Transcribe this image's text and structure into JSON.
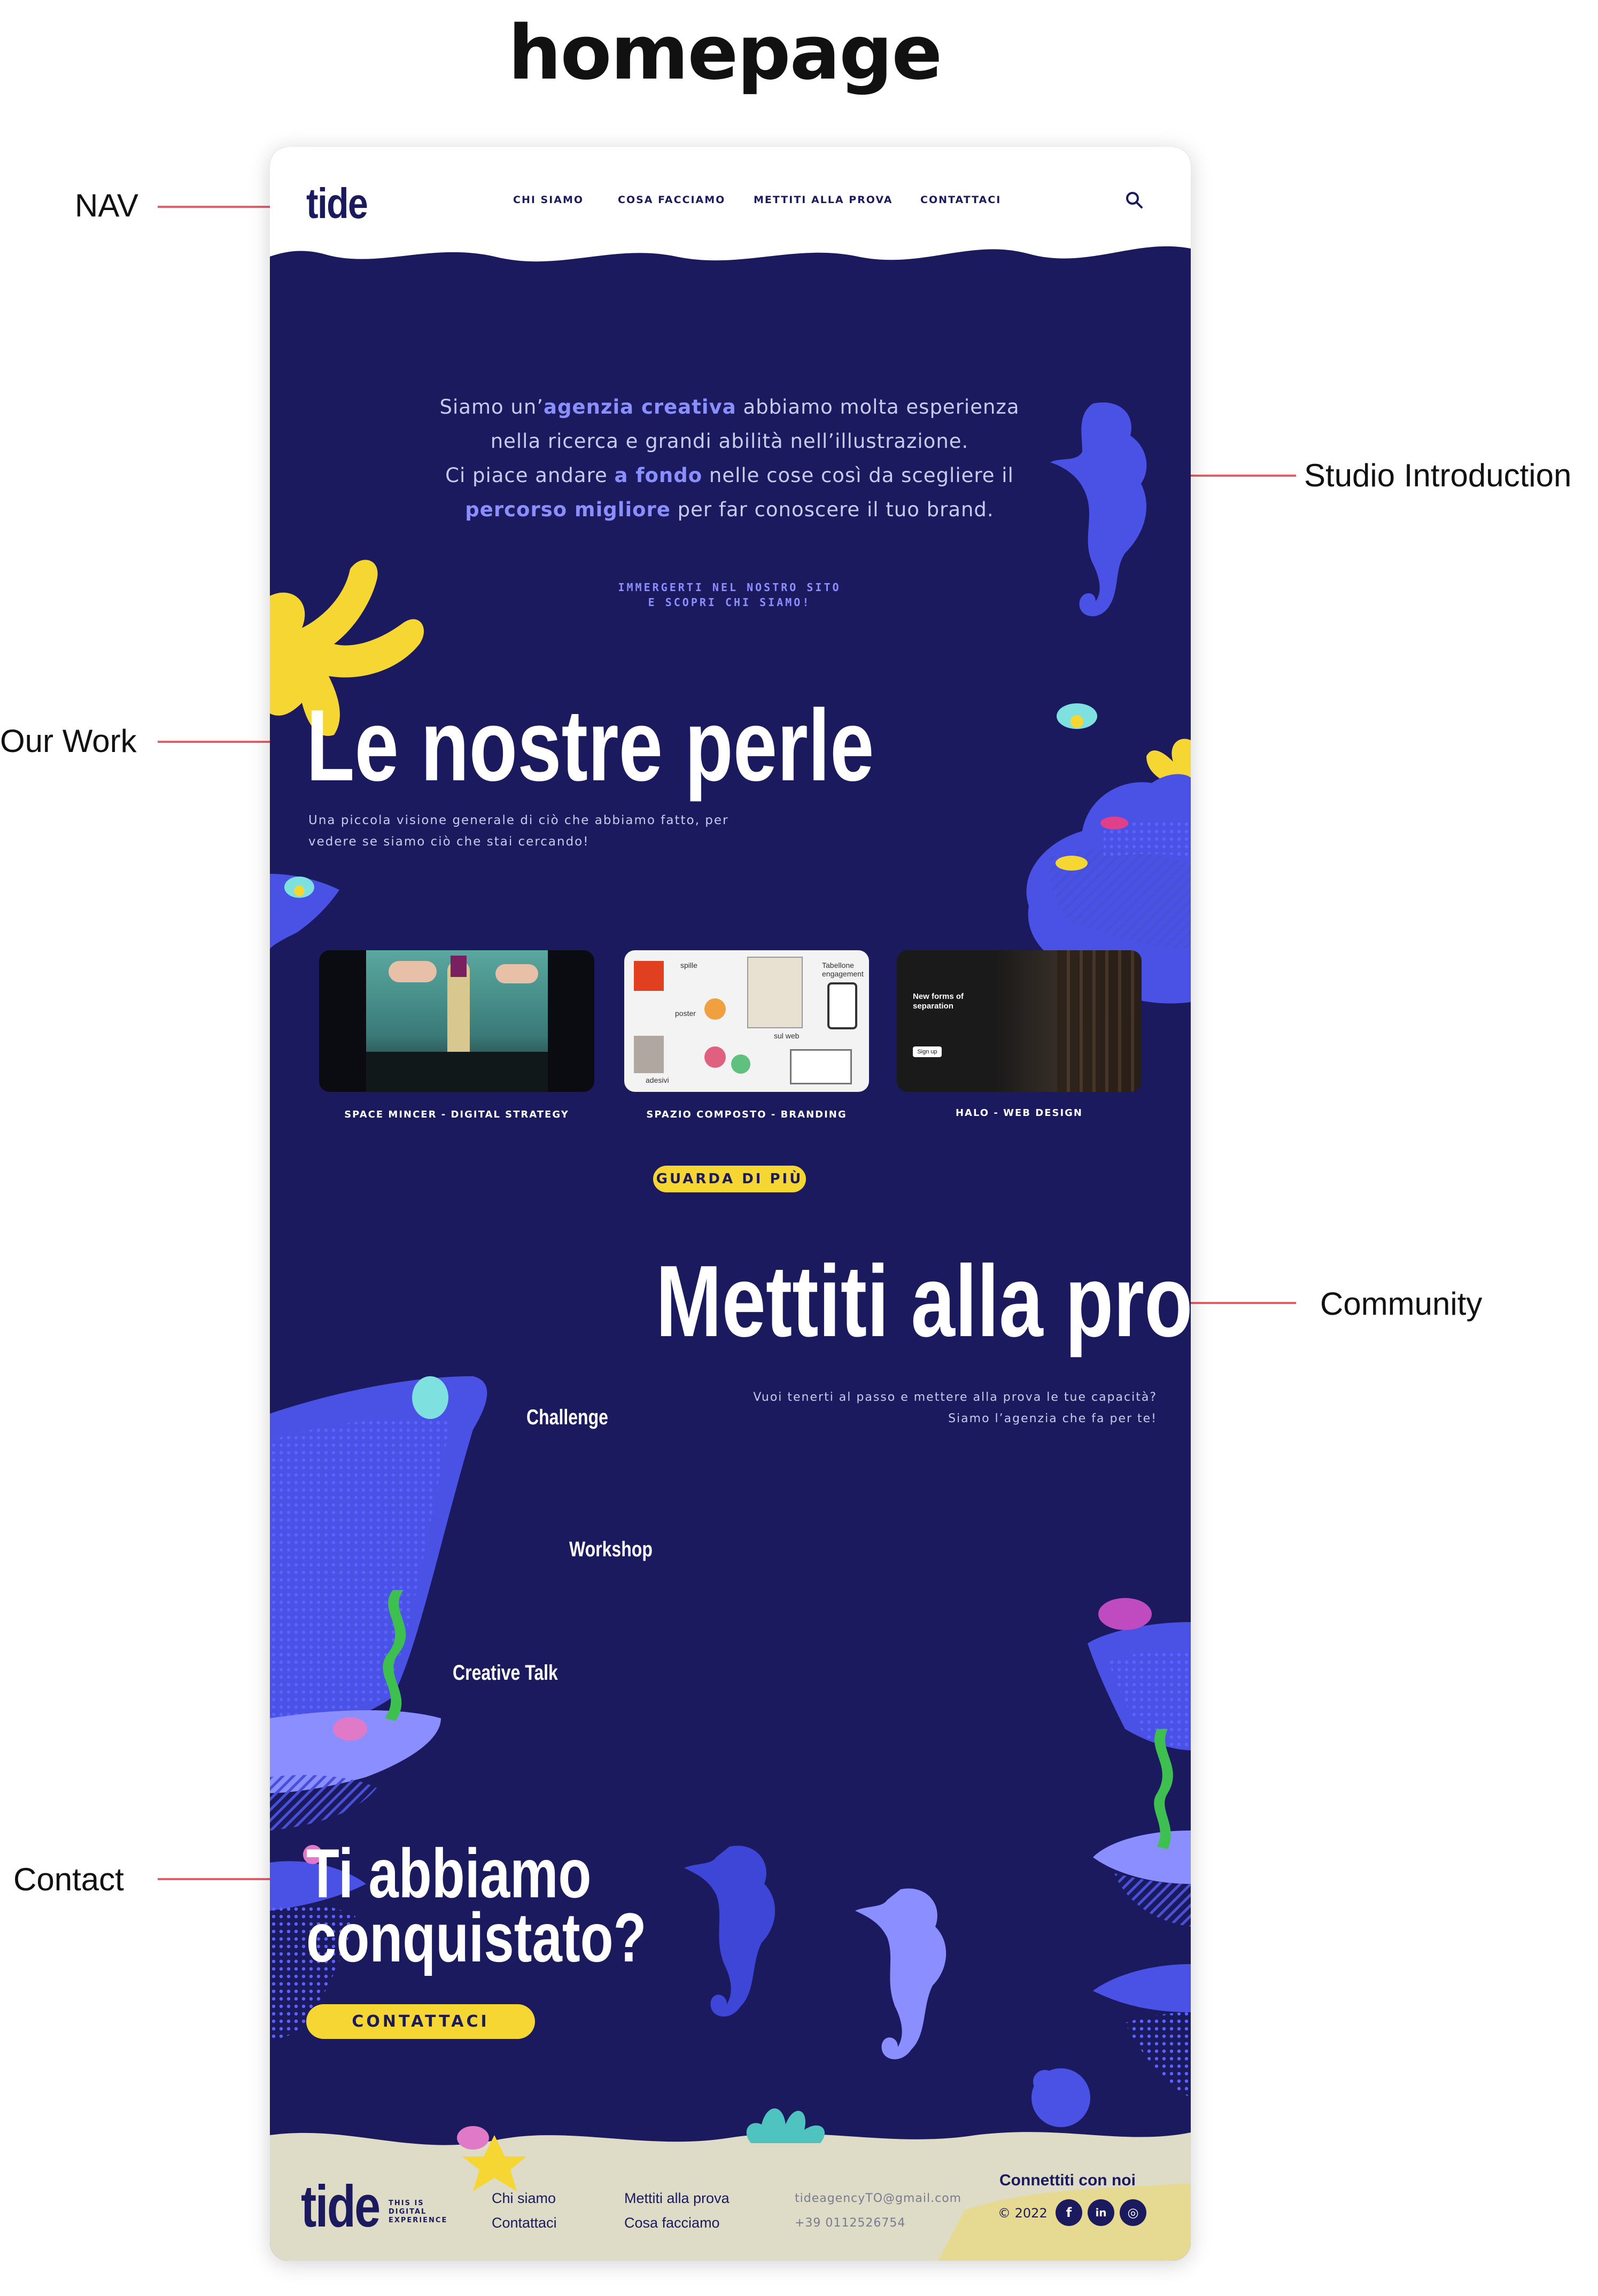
{
  "page_title": "homepage",
  "callouts": {
    "nav": "NAV",
    "studio_intro": "Studio Introduction",
    "our_work": "Our Work",
    "community": "Community",
    "contact": "Contact"
  },
  "nav": {
    "logo": "tide",
    "links": [
      "Chi siamo",
      "Cosa facciamo",
      "Mettiti alla prova",
      "Contattaci"
    ],
    "search_icon": "search-icon"
  },
  "intro": {
    "line1_a": "Siamo un’",
    "line1_b": "agenzia creativa",
    "line1_c": " abbiamo molta esperienza",
    "line2": "nella ricerca e grandi abilità nell’illustrazione.",
    "line3_a": "Ci piace andare ",
    "line3_b": "a fondo",
    "line3_c": " nelle cose così da scegliere il",
    "line4_a": "percorso migliore",
    "line4_b": " per far conoscere il tuo brand.",
    "cta_line1": "Immergerti nel nostro sito",
    "cta_line2": "e scopri chi siamo!"
  },
  "work": {
    "title": "Le nostre perle",
    "subtitle_line1": "Una piccola visione generale di ciò che abbiamo fatto, per",
    "subtitle_line2": "vedere se siamo ciò che stai cercando!",
    "cards": [
      {
        "label": "Space Mincer - Digital Strategy"
      },
      {
        "label": "Spazio Composto - Branding",
        "tags": [
          "spille",
          "Tabellone engagement",
          "poster",
          "sul web",
          "adesivi"
        ]
      },
      {
        "label": "Halo - Web Design",
        "headline": "New forms of separation",
        "button": "Sign up"
      }
    ],
    "more_button": "Guarda di più"
  },
  "community": {
    "title": "Mettiti alla prova",
    "text_line1": "Vuoi tenerti al passo e mettere alla prova le tue capacità?",
    "text_line2": "Siamo l’agenzia che fa per te!",
    "items": [
      "Challenge",
      "Workshop",
      "Creative Talk"
    ]
  },
  "contact": {
    "title_line1": "Ti abbiamo",
    "title_line2": "conquistato?",
    "button": "Contattaci"
  },
  "footer": {
    "logo": "tide",
    "tagline_line1": "THIS IS",
    "tagline_line2": "DIGITAL",
    "tagline_line3": "EXPERIENCE",
    "col1": [
      "Chi siamo",
      "Contattaci"
    ],
    "col2": [
      "Mettiti alla prova",
      "Cosa facciamo"
    ],
    "email": "tideagencyTO@gmail.com",
    "phone": "+39 0112526754",
    "connect": "Connettiti con noi",
    "copyright": "© 2022",
    "socials": [
      "f",
      "in",
      "◎"
    ]
  },
  "colors": {
    "navy": "#1b1a5e",
    "accent_blue": "#8a8eff",
    "yellow": "#f6d633",
    "sand": "#dedcc6",
    "callout_red": "#e0606a"
  }
}
